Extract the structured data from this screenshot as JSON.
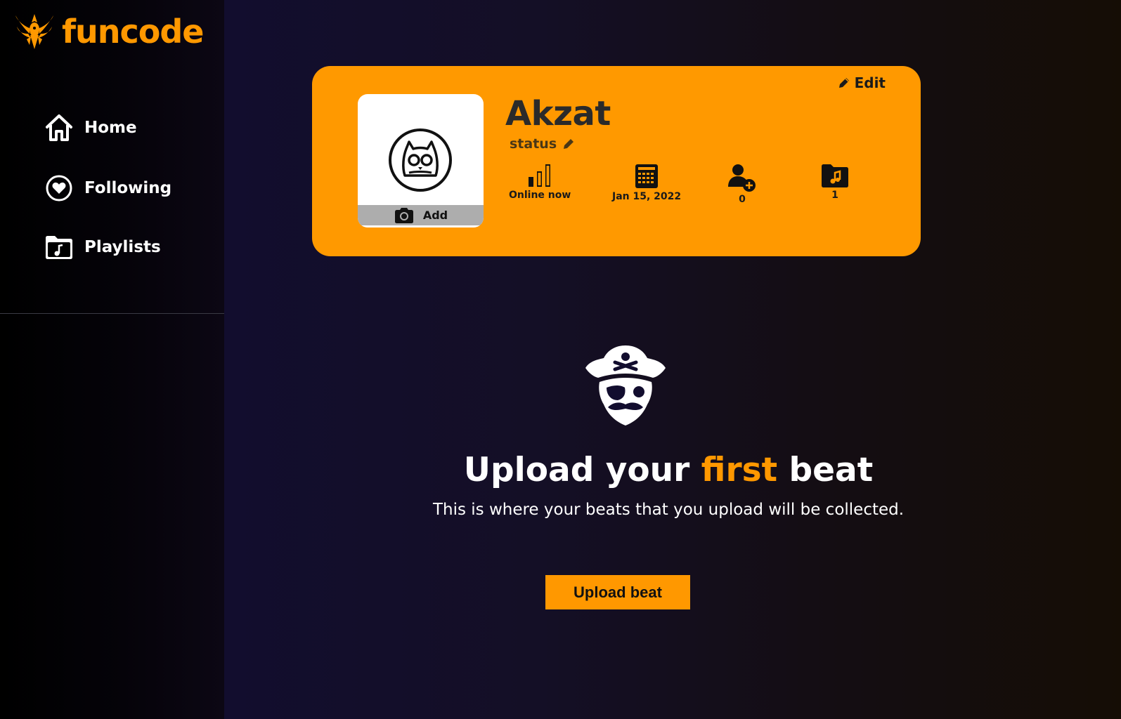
{
  "app": {
    "name": "funcode"
  },
  "colors": {
    "accent": "#ff9800",
    "card": "#ff9900"
  },
  "sidebar": {
    "items": [
      {
        "label": "Home",
        "icon": "home-icon"
      },
      {
        "label": "Following",
        "icon": "heart-circle-icon"
      },
      {
        "label": "Playlists",
        "icon": "music-folder-icon"
      }
    ]
  },
  "profile": {
    "edit_label": "Edit",
    "name": "Akzat",
    "status_label": "status",
    "avatar_add_label": "Add",
    "stats": [
      {
        "icon": "signal-bars-icon",
        "label": "Online now"
      },
      {
        "icon": "calendar-icon",
        "label": "Jan 15, 2022"
      },
      {
        "icon": "add-user-icon",
        "label": "0"
      },
      {
        "icon": "music-folder-icon",
        "label": "1"
      }
    ]
  },
  "empty_state": {
    "icon": "pirate-icon",
    "title_part1": "Upload your ",
    "title_accent": "first",
    "title_part2": " beat",
    "description": "This is where your beats that you upload will be collected.",
    "button_label": "Upload beat"
  }
}
